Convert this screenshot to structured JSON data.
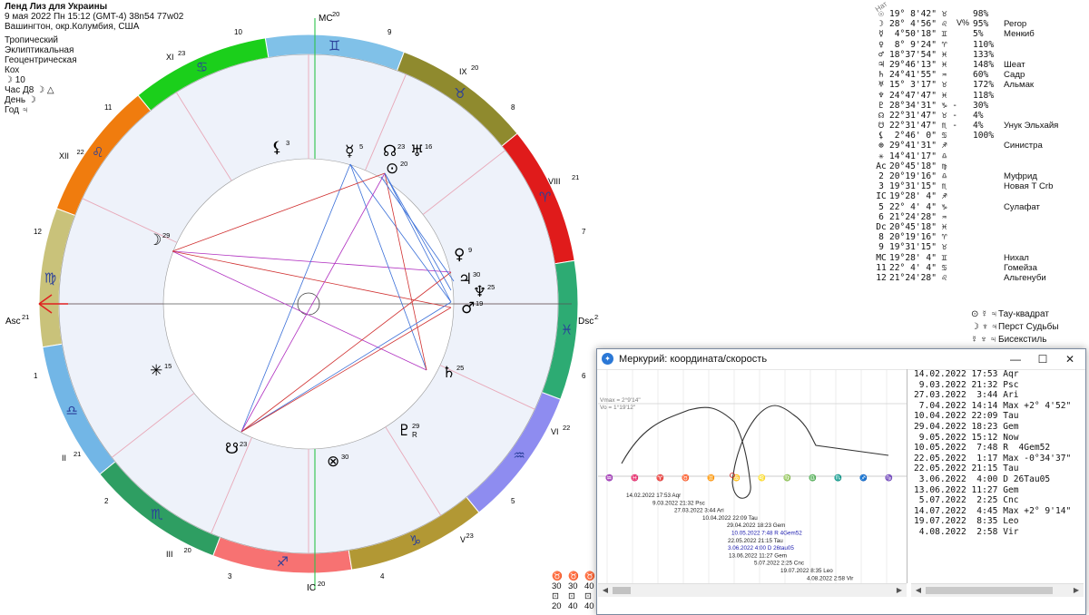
{
  "header": {
    "title": "Ленд Лиз для Украины",
    "line2": "9 мая 2022  Пн  15:12 (GMT-4) 38n54  77w02",
    "line3": "Вашингтон, окр.Колумбия, США",
    "settings": [
      "Тропический",
      "Эклиптикальная",
      "Геоцентрическая",
      "Кох"
    ],
    "extra": [
      "☽ 10",
      "Час Д8 ☽ △",
      "День ☽",
      "Год ♃"
    ]
  },
  "wheel": {
    "ring_colors": {
      "aries": "#e01b1b",
      "taurus": "#8f8a2e",
      "gemini": "#80c1e8",
      "cancer": "#1bcf1b",
      "leo": "#f07c0e",
      "virgo": "#c9c27a",
      "libra": "#72b6e6",
      "scorpio": "#2e9e62",
      "sagittarius": "#f77272",
      "capricorn": "#b29834",
      "aquarius": "#8e8cf0",
      "pisces": "#2dab73"
    },
    "signs": [
      "♈",
      "♉",
      "♊",
      "♋",
      "♌",
      "♍",
      "♎",
      "♏",
      "♐",
      "♑",
      "♒",
      "♓"
    ],
    "house_cusps": [
      {
        "label": "XI",
        "deg": "23"
      },
      {
        "label": "IX",
        "deg": "20"
      },
      {
        "label": "XII",
        "deg": "22"
      },
      {
        "label": "VIII",
        "deg": "21"
      },
      {
        "label": "II",
        "deg": "21"
      },
      {
        "label": "VI",
        "deg": "22"
      },
      {
        "label": "III",
        "deg": "20"
      },
      {
        "label": "V",
        "deg": "23"
      }
    ],
    "angles": {
      "mc": "MC",
      "mc_deg": "20",
      "ic": "IC",
      "ic_deg": "20",
      "asc": "Asc",
      "asc_deg": "21",
      "dsc": "Dsc",
      "dsc_deg": "21"
    },
    "house_numbers": [
      "1",
      "2",
      "3",
      "4",
      "5",
      "6",
      "7",
      "8",
      "9",
      "10",
      "11",
      "12"
    ],
    "planets": [
      {
        "name": "Селена",
        "glyph": "⚸",
        "deg": "3"
      },
      {
        "name": "Меркурий",
        "glyph": "☿",
        "deg": "5"
      },
      {
        "name": "Узел",
        "glyph": "☊",
        "deg": "23"
      },
      {
        "name": "Плутон",
        "glyph": "♅",
        "deg": "16"
      },
      {
        "name": "Солнце",
        "glyph": "⊙",
        "deg": "20"
      },
      {
        "name": "Венера",
        "glyph": "♀",
        "deg": "9"
      },
      {
        "name": "Юпитер",
        "glyph": "♃",
        "deg": "30"
      },
      {
        "name": "Нептун",
        "glyph": "♆",
        "deg": "25"
      },
      {
        "name": "Марс",
        "glyph": "♂",
        "deg": "19"
      },
      {
        "name": "Луна",
        "glyph": "☽",
        "deg": "29"
      },
      {
        "name": "Сатурн",
        "glyph": "♄",
        "deg": "25"
      },
      {
        "name": "Плутон R",
        "glyph": "♇",
        "deg": "29",
        "flag": "R"
      },
      {
        "name": "Южный узел",
        "glyph": "☋",
        "deg": "23"
      },
      {
        "name": "Фортуна",
        "glyph": "⊗",
        "deg": "30"
      },
      {
        "name": "Звезда",
        "glyph": "✳",
        "deg": "15"
      }
    ]
  },
  "table": {
    "header": "Нат",
    "vh": "V%",
    "rows": [
      {
        "g": "☉",
        "v": "19° 8'42\" ♉",
        "p": "98%",
        "n": ""
      },
      {
        "g": "☽",
        "v": "28° 4'56\" ♌",
        "p": "95%",
        "n": "Регор"
      },
      {
        "g": "☿",
        "v": " 4°50'18\" ♊",
        "p": "5%",
        "n": "Менкиб"
      },
      {
        "g": "♀",
        "v": " 8° 9'24\" ♈",
        "p": "110%",
        "n": ""
      },
      {
        "g": "♂",
        "v": "18°37'54\" ♓",
        "p": "133%",
        "n": ""
      },
      {
        "g": "♃",
        "v": "29°46'13\" ♓",
        "p": "148%",
        "n": "Шеат"
      },
      {
        "g": "♄",
        "v": "24°41'55\" ♒",
        "p": "60%",
        "n": "Садр"
      },
      {
        "g": "♅",
        "v": "15° 3'17\" ♉",
        "p": "172%",
        "n": "Альмак"
      },
      {
        "g": "♆",
        "v": "24°47'47\" ♓",
        "p": "118%",
        "n": ""
      },
      {
        "g": "♇",
        "v": "28°34'31\" ♑ -",
        "p": "30%",
        "n": ""
      },
      {
        "g": "☊",
        "v": "22°31'47\" ♉ -",
        "p": "4%",
        "n": ""
      },
      {
        "g": "☋",
        "v": "22°31'47\" ♏ -",
        "p": "4%",
        "n": "Унук Эльхайя"
      },
      {
        "g": "⚸",
        "v": " 2°46' 0\" ♋",
        "p": "100%",
        "n": ""
      },
      {
        "g": "⊕",
        "v": "29°41'31\" ♐",
        "p": "",
        "n": "Синистра"
      },
      {
        "g": "✳",
        "v": "14°41'17\" ♎",
        "p": "",
        "n": ""
      },
      {
        "g": "Ac",
        "v": "20°45'18\" ♍",
        "p": "",
        "n": ""
      },
      {
        "g": "2",
        "v": "20°19'16\" ♎",
        "p": "",
        "n": "Муфрид"
      },
      {
        "g": "3",
        "v": "19°31'15\" ♏",
        "p": "",
        "n": "Новая Т Crb"
      },
      {
        "g": "IC",
        "v": "19°28' 4\" ♐",
        "p": "",
        "n": ""
      },
      {
        "g": "5",
        "v": "22° 4' 4\" ♑",
        "p": "",
        "n": "Сулафат"
      },
      {
        "g": "6",
        "v": "21°24'28\" ♒",
        "p": "",
        "n": ""
      },
      {
        "g": "Dc",
        "v": "20°45'18\" ♓",
        "p": "",
        "n": ""
      },
      {
        "g": "8",
        "v": "20°19'16\" ♈",
        "p": "",
        "n": ""
      },
      {
        "g": "9",
        "v": "19°31'15\" ♉",
        "p": "",
        "n": ""
      },
      {
        "g": "MC",
        "v": "19°28' 4\" ♊",
        "p": "",
        "n": "Нихал"
      },
      {
        "g": "11",
        "v": "22° 4' 4\" ♋",
        "p": "",
        "n": "Гомейза"
      },
      {
        "g": "12",
        "v": "21°24'28\" ♌",
        "p": "",
        "n": "Альгенуби"
      }
    ]
  },
  "configurations": [
    {
      "glyphs": "⊙ ☿ ♃",
      "name": "Тау-квадрат"
    },
    {
      "glyphs": "☽ ♆ ♃",
      "name": "Перст Судьбы"
    },
    {
      "glyphs": "☿ ♆ ♃",
      "name": "Бисекстиль"
    }
  ],
  "legend_grid": [
    [
      "♉",
      "♉",
      "♉"
    ],
    [
      "30",
      "30",
      "40"
    ],
    [
      "⊡",
      "⊡",
      "⊡"
    ],
    [
      "20",
      "40",
      "40"
    ]
  ],
  "dialog": {
    "title": "Меркурий: координата/скорость",
    "vmax": "Vmax = 2°9'14\"",
    "vo": "Vo = 1°19'12\"",
    "events": [
      "14.02.2022 17:53 Aqr",
      " 9.03.2022 21:32 Psc",
      "27.03.2022  3:44 Ari",
      " 7.04.2022 14:14 Max +2° 4'52\"",
      "10.04.2022 22:09 Tau",
      "29.04.2022 18:23 Gem",
      " 9.05.2022 15:12 Now",
      "10.05.2022  7:48 R  4Gem52",
      "22.05.2022  1:17 Max -0°34'37\"",
      "22.05.2022 21:15 Tau",
      " 3.06.2022  4:00 D 26Tau05",
      "13.06.2022 11:27 Gem",
      " 5.07.2022  2:25 Cnc",
      "14.07.2022  4:45 Max +2° 9'14\"",
      "19.07.2022  8:35 Leo",
      " 4.08.2022  2:58 Vir"
    ],
    "graph_labels": [
      "14.02.2022 17:53 Aqr",
      "9.03.2022 21:32 Psc",
      "27.03.2022  3:44 Ari",
      "10.04.2022 22:09 Tau",
      "29.04.2022 18:23 Gem",
      "10.05.2022  7:48 R  4Gem52",
      "22.05.2022 21:15 Tau",
      "3.06.2022  4:00 D 26tau05",
      "13.06.2022 11:27 Gem",
      "5.07.2022  2:25 Cnc",
      "19.07.2022  8:35 Leo",
      "4.08.2022  2:58 Vir"
    ]
  }
}
